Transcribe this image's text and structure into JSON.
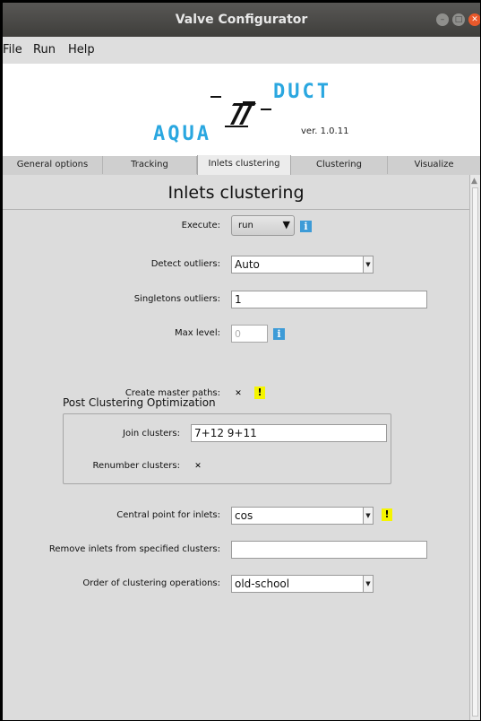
{
  "window": {
    "title": "Valve Configurator"
  },
  "menu": {
    "file": "File",
    "run": "Run",
    "help": "Help"
  },
  "logo": {
    "aqua": "AQUA",
    "duct": "DUCT",
    "version": "ver. 1.0.11"
  },
  "tabs": [
    {
      "label": "General options"
    },
    {
      "label": "Tracking"
    },
    {
      "label": "Inlets clustering"
    },
    {
      "label": "Clustering"
    },
    {
      "label": "Visualize"
    }
  ],
  "active_tab": "Inlets clustering",
  "page": {
    "title": "Inlets clustering",
    "execute": {
      "label": "Execute:",
      "value": "run",
      "info": "i"
    },
    "detect_outliers": {
      "label": "Detect outliers:",
      "value": "Auto"
    },
    "singletons_outliers": {
      "label": "Singletons outliers:",
      "value": "1"
    },
    "max_level": {
      "label": "Max level:",
      "value": "0",
      "info": "i"
    },
    "create_master_paths": {
      "label": "Create master paths:",
      "checked": true,
      "warning": "!"
    },
    "post_clustering": {
      "title": "Post Clustering Optimization",
      "join_clusters": {
        "label": "Join clusters:",
        "value": "7+12 9+11"
      },
      "renumber_clusters": {
        "label": "Renumber clusters:",
        "checked": true
      }
    },
    "central_point": {
      "label": "Central point for inlets:",
      "value": "cos",
      "warning": "!"
    },
    "remove_inlets": {
      "label": "Remove inlets from specified clusters:",
      "value": ""
    },
    "order_ops": {
      "label": "Order of clustering operations:",
      "value": "old-school"
    }
  },
  "colors": {
    "accent": "#2aa7e0",
    "info": "#3d9bd7",
    "warning": "#f5f500",
    "close": "#e9592b"
  }
}
